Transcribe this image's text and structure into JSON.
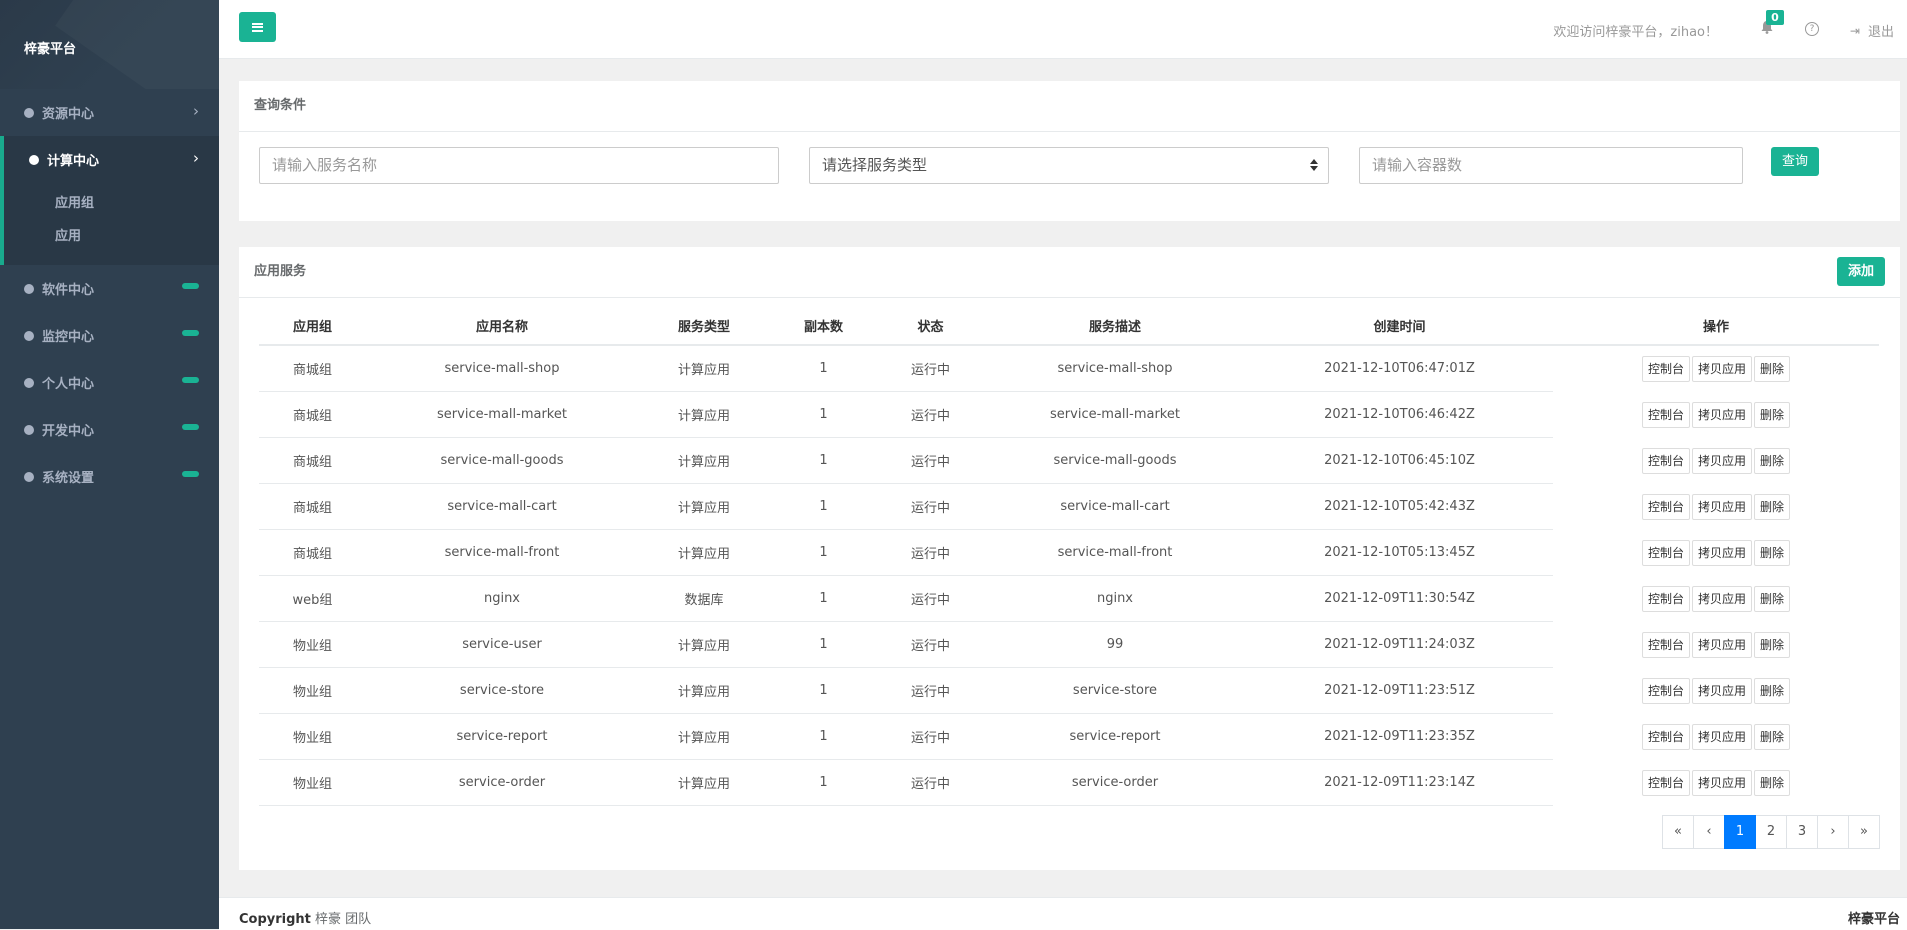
{
  "sidebar": {
    "brand": "梓豪平台",
    "items": [
      {
        "label": "资源中心"
      },
      {
        "label": "计算中心"
      },
      {
        "label": "软件中心"
      },
      {
        "label": "监控中心"
      },
      {
        "label": "个人中心"
      },
      {
        "label": "开发中心"
      },
      {
        "label": "系统设置"
      }
    ],
    "submenu": [
      "应用组",
      "应用"
    ]
  },
  "topbar": {
    "welcome": "欢迎访问梓豪平台，zihao！",
    "notification_count": "0",
    "logout": "退出"
  },
  "query": {
    "title": "查询条件",
    "name_placeholder": "请输入服务名称",
    "type_select": "请选择服务类型",
    "replica_placeholder": "请输入容器数",
    "search_button": "查询"
  },
  "table_panel": {
    "title": "应用服务",
    "add_button": "添加",
    "columns": [
      "应用组",
      "应用名称",
      "服务类型",
      "副本数",
      "状态",
      "服务描述",
      "创建时间",
      "操作"
    ],
    "ops": [
      "控制台",
      "拷贝应用",
      "删除"
    ],
    "rows": [
      [
        "商城组",
        "service-mall-shop",
        "计算应用",
        "1",
        "运行中",
        "service-mall-shop",
        "2021-12-10T06:47:01Z"
      ],
      [
        "商城组",
        "service-mall-market",
        "计算应用",
        "1",
        "运行中",
        "service-mall-market",
        "2021-12-10T06:46:42Z"
      ],
      [
        "商城组",
        "service-mall-goods",
        "计算应用",
        "1",
        "运行中",
        "service-mall-goods",
        "2021-12-10T06:45:10Z"
      ],
      [
        "商城组",
        "service-mall-cart",
        "计算应用",
        "1",
        "运行中",
        "service-mall-cart",
        "2021-12-10T05:42:43Z"
      ],
      [
        "商城组",
        "service-mall-front",
        "计算应用",
        "1",
        "运行中",
        "service-mall-front",
        "2021-12-10T05:13:45Z"
      ],
      [
        "web组",
        "nginx",
        "数据库",
        "1",
        "运行中",
        "nginx",
        "2021-12-09T11:30:54Z"
      ],
      [
        "物业组",
        "service-user",
        "计算应用",
        "1",
        "运行中",
        "99",
        "2021-12-09T11:24:03Z"
      ],
      [
        "物业组",
        "service-store",
        "计算应用",
        "1",
        "运行中",
        "service-store",
        "2021-12-09T11:23:51Z"
      ],
      [
        "物业组",
        "service-report",
        "计算应用",
        "1",
        "运行中",
        "service-report",
        "2021-12-09T11:23:35Z"
      ],
      [
        "物业组",
        "service-order",
        "计算应用",
        "1",
        "运行中",
        "service-order",
        "2021-12-09T11:23:14Z"
      ]
    ],
    "pagination": [
      "«",
      "‹",
      "1",
      "2",
      "3",
      "›",
      "»"
    ],
    "current_page": "1"
  },
  "footer": {
    "copyright_label": "Copyright",
    "copyright_owner": "梓豪 团队",
    "brand": "梓豪平台"
  },
  "colors": {
    "sidebar_bg": "#2f4050",
    "accent": "#1ab394",
    "active_page": "#007bff"
  }
}
